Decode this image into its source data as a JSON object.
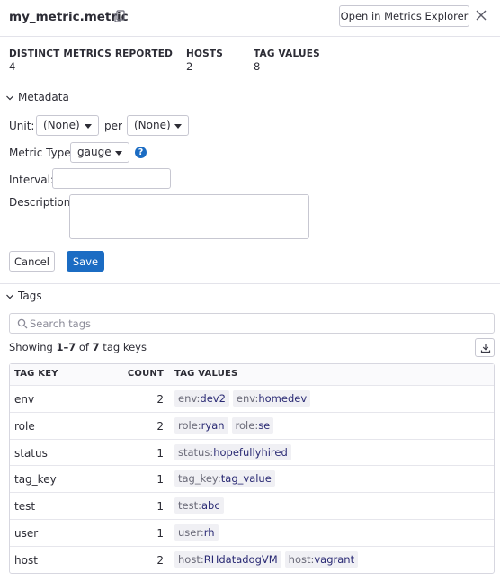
{
  "header": {
    "title": "my_metric.metric",
    "open_button": "Open in Metrics Explorer"
  },
  "stats": [
    {
      "label": "DISTINCT METRICS REPORTED",
      "value": "4"
    },
    {
      "label": "HOSTS",
      "value": "2"
    },
    {
      "label": "TAG VALUES",
      "value": "8"
    }
  ],
  "metadata": {
    "section_title": "Metadata",
    "unit_label": "Unit:",
    "unit_value": "(None)",
    "per_label": "per",
    "per_value": "(None)",
    "metric_type_label": "Metric Type:",
    "metric_type_value": "gauge",
    "help_glyph": "?",
    "interval_label": "Interval:",
    "interval_value": "",
    "description_label": "Description:",
    "description_value": "",
    "cancel_label": "Cancel",
    "save_label": "Save"
  },
  "tags": {
    "section_title": "Tags",
    "search_placeholder": "Search tags",
    "showing_prefix": "Showing ",
    "showing_range": "1–7",
    "showing_of": " of ",
    "showing_total": "7",
    "showing_suffix": " tag keys",
    "columns": {
      "key": "TAG KEY",
      "count": "COUNT",
      "values": "TAG VALUES"
    },
    "rows": [
      {
        "key": "env",
        "count": "2",
        "values": [
          {
            "k": "env:",
            "v": "dev2"
          },
          {
            "k": "env:",
            "v": "homedev"
          }
        ]
      },
      {
        "key": "role",
        "count": "2",
        "values": [
          {
            "k": "role:",
            "v": "ryan"
          },
          {
            "k": "role:",
            "v": "se"
          }
        ]
      },
      {
        "key": "status",
        "count": "1",
        "values": [
          {
            "k": "status:",
            "v": "hopefullyhired"
          }
        ]
      },
      {
        "key": "tag_key",
        "count": "1",
        "values": [
          {
            "k": "tag_key:",
            "v": "tag_value"
          }
        ]
      },
      {
        "key": "test",
        "count": "1",
        "values": [
          {
            "k": "test:",
            "v": "abc"
          }
        ]
      },
      {
        "key": "user",
        "count": "1",
        "values": [
          {
            "k": "user:",
            "v": "rh"
          }
        ]
      },
      {
        "key": "host",
        "count": "2",
        "values": [
          {
            "k": "host:",
            "v": "RHdatadogVM"
          },
          {
            "k": "host:",
            "v": "vagrant"
          }
        ]
      }
    ]
  },
  "colors": {
    "accent": "#1b6cc3",
    "border": "#c7c7d1"
  },
  "icons": [
    "copy-icon",
    "close-icon",
    "chevron-down-icon",
    "help-icon",
    "search-icon",
    "download-icon",
    "caret-down-icon"
  ]
}
